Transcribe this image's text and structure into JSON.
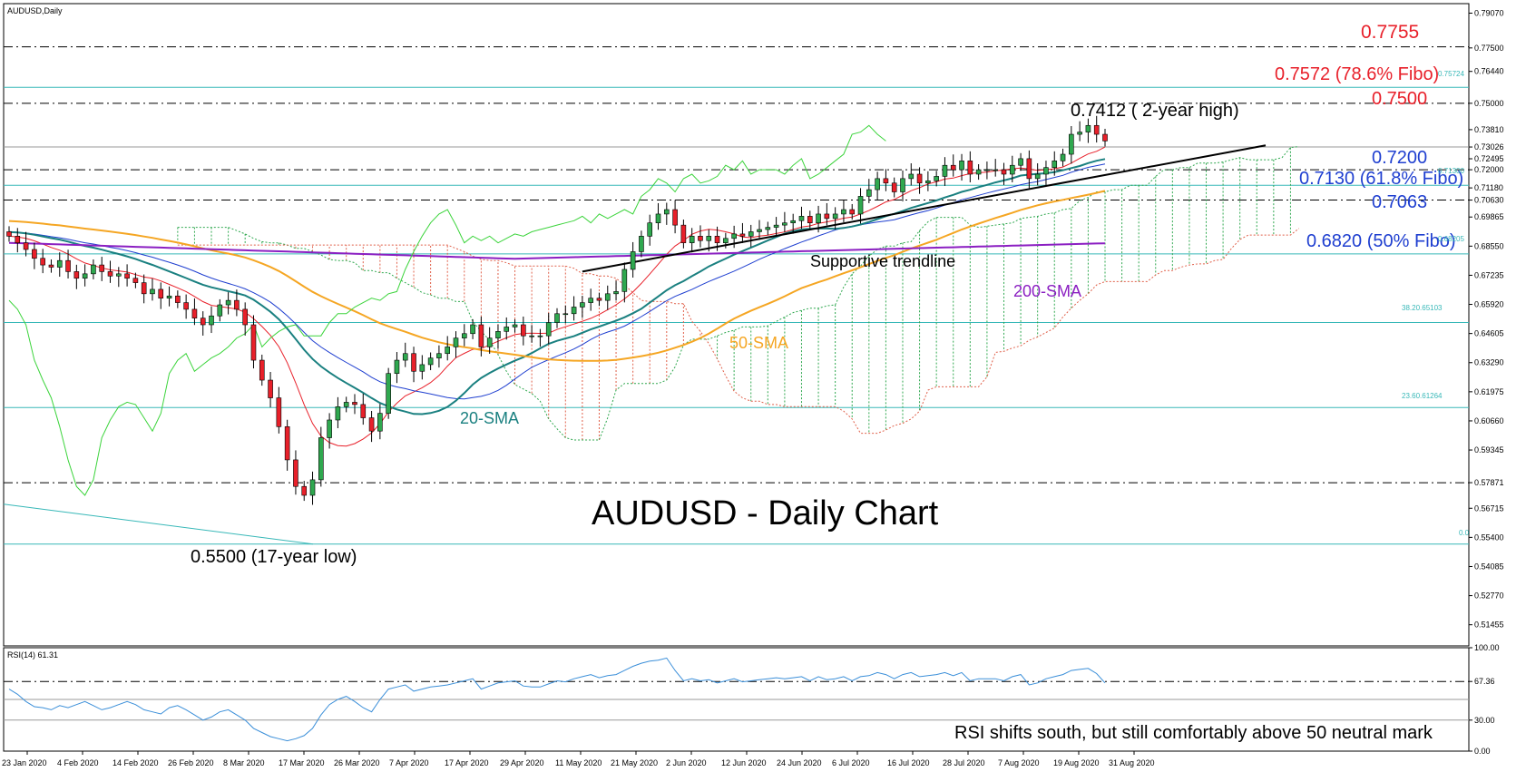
{
  "chart_data": {
    "type": "candlestick",
    "symbol_label": "AUDUSD,Daily",
    "title": "AUDUSD - Daily Chart",
    "rsi_label": "RSI(14) 61.31",
    "x_tick_labels": [
      "23 Jan 2020",
      "4 Feb 2020",
      "14 Feb 2020",
      "26 Feb 2020",
      "8 Mar 2020",
      "17 Mar 2020",
      "26 Mar 2020",
      "7 Apr 2020",
      "17 Apr 2020",
      "29 Apr 2020",
      "11 May 2020",
      "21 May 2020",
      "2 Jun 2020",
      "12 Jun 2020",
      "24 Jun 2020",
      "6 Jul 2020",
      "16 Jul 2020",
      "28 Jul 2020",
      "7 Aug 2020",
      "19 Aug 2020",
      "31 Aug 2020"
    ],
    "y_tick_labels": [
      "0.79070",
      "0.77500",
      "0.76440",
      "0.75000",
      "0.73810",
      "0.73026",
      "0.72495",
      "0.72000",
      "0.71180",
      "0.70630",
      "0.69865",
      "0.68550",
      "0.67235",
      "0.65920",
      "0.64605",
      "0.63290",
      "0.61975",
      "0.60660",
      "0.59345",
      "0.57871",
      "0.56715",
      "0.55400",
      "0.54085",
      "0.52770",
      "0.51455"
    ],
    "ylim": [
      0.505,
      0.795
    ],
    "rsi_tick_labels": [
      "100.00",
      "67.36",
      "30.00",
      "0.00"
    ],
    "rsi_ylim": [
      0,
      100
    ],
    "levels": [
      {
        "value": 0.7755,
        "label": "0.7755",
        "style": "dashdot"
      },
      {
        "value": 0.7572,
        "label": "0.7572 (78.6% Fibo)",
        "style": "fibo"
      },
      {
        "value": 0.75,
        "label": "0.7500",
        "style": "dashdot"
      },
      {
        "value": 0.72,
        "label": "0.7200",
        "style": "dashdot"
      },
      {
        "value": 0.713,
        "label": "0.7130 (61.8% Fibo)",
        "style": "fibo"
      },
      {
        "value": 0.7063,
        "label": "0.7063",
        "style": "dashdot"
      },
      {
        "value": 0.682,
        "label": "0.6820 (50% Fibo)",
        "style": "fibo"
      },
      {
        "value": 0.651,
        "label": "38.20.65103",
        "style": "fibo"
      },
      {
        "value": 0.6126,
        "label": "23.60.61264",
        "style": "fibo"
      },
      {
        "value": 0.5787,
        "label": "",
        "style": "dashdot"
      },
      {
        "value": 0.551,
        "label": "0.0",
        "style": "fibo"
      }
    ],
    "fibo_small_labels": [
      "0.75724",
      "0.71300",
      "0.68205"
    ],
    "annotations": {
      "high": "0.7412 ( 2-year high)",
      "low": "0.5500 (17-year low)",
      "trendline": "Supportive trendline",
      "sma20": "20-SMA",
      "sma50": "50-SMA",
      "sma200": "200-SMA",
      "rsi_note": "RSI shifts south, but still comfortably above 50 neutral mark"
    },
    "closes": [
      0.69,
      0.687,
      0.684,
      0.68,
      0.677,
      0.676,
      0.679,
      0.674,
      0.671,
      0.673,
      0.677,
      0.674,
      0.672,
      0.673,
      0.671,
      0.669,
      0.664,
      0.666,
      0.662,
      0.663,
      0.66,
      0.657,
      0.653,
      0.65,
      0.654,
      0.659,
      0.661,
      0.657,
      0.65,
      0.634,
      0.625,
      0.617,
      0.604,
      0.589,
      0.577,
      0.573,
      0.58,
      0.599,
      0.607,
      0.613,
      0.615,
      0.614,
      0.608,
      0.602,
      0.61,
      0.628,
      0.634,
      0.637,
      0.629,
      0.632,
      0.635,
      0.637,
      0.64,
      0.644,
      0.646,
      0.65,
      0.64,
      0.644,
      0.647,
      0.649,
      0.65,
      0.645,
      0.645,
      0.645,
      0.651,
      0.655,
      0.655,
      0.658,
      0.66,
      0.662,
      0.661,
      0.664,
      0.665,
      0.675,
      0.683,
      0.69,
      0.696,
      0.7,
      0.702,
      0.695,
      0.687,
      0.69,
      0.688,
      0.69,
      0.687,
      0.689,
      0.691,
      0.69,
      0.692,
      0.693,
      0.694,
      0.695,
      0.696,
      0.697,
      0.699,
      0.696,
      0.7,
      0.698,
      0.7,
      0.702,
      0.7,
      0.708,
      0.711,
      0.716,
      0.714,
      0.71,
      0.716,
      0.718,
      0.714,
      0.715,
      0.717,
      0.722,
      0.72,
      0.724,
      0.718,
      0.72,
      0.72,
      0.72,
      0.718,
      0.722,
      0.725,
      0.716,
      0.718,
      0.721,
      0.724,
      0.727,
      0.736,
      0.737,
      0.74,
      0.736,
      0.733
    ],
    "rsi_values": [
      60,
      55,
      48,
      43,
      42,
      40,
      44,
      42,
      45,
      48,
      44,
      40,
      42,
      45,
      48,
      45,
      40,
      38,
      36,
      42,
      44,
      40,
      35,
      30,
      33,
      38,
      40,
      35,
      30,
      22,
      18,
      14,
      12,
      10,
      12,
      15,
      22,
      35,
      45,
      50,
      53,
      48,
      42,
      38,
      50,
      60,
      62,
      64,
      58,
      60,
      62,
      63,
      64,
      66,
      68,
      70,
      60,
      63,
      66,
      67,
      68,
      63,
      62,
      62,
      65,
      68,
      67,
      70,
      72,
      74,
      71,
      73,
      74,
      78,
      82,
      85,
      87,
      88,
      90,
      78,
      68,
      70,
      68,
      69,
      66,
      68,
      70,
      67,
      68,
      69,
      70,
      71,
      70,
      71,
      72,
      68,
      72,
      69,
      70,
      72,
      68,
      72,
      73,
      76,
      74,
      70,
      74,
      76,
      72,
      73,
      74,
      76,
      73,
      76,
      68,
      70,
      70,
      70,
      68,
      72,
      74,
      64,
      66,
      70,
      72,
      74,
      78,
      79,
      80,
      75,
      66
    ]
  }
}
